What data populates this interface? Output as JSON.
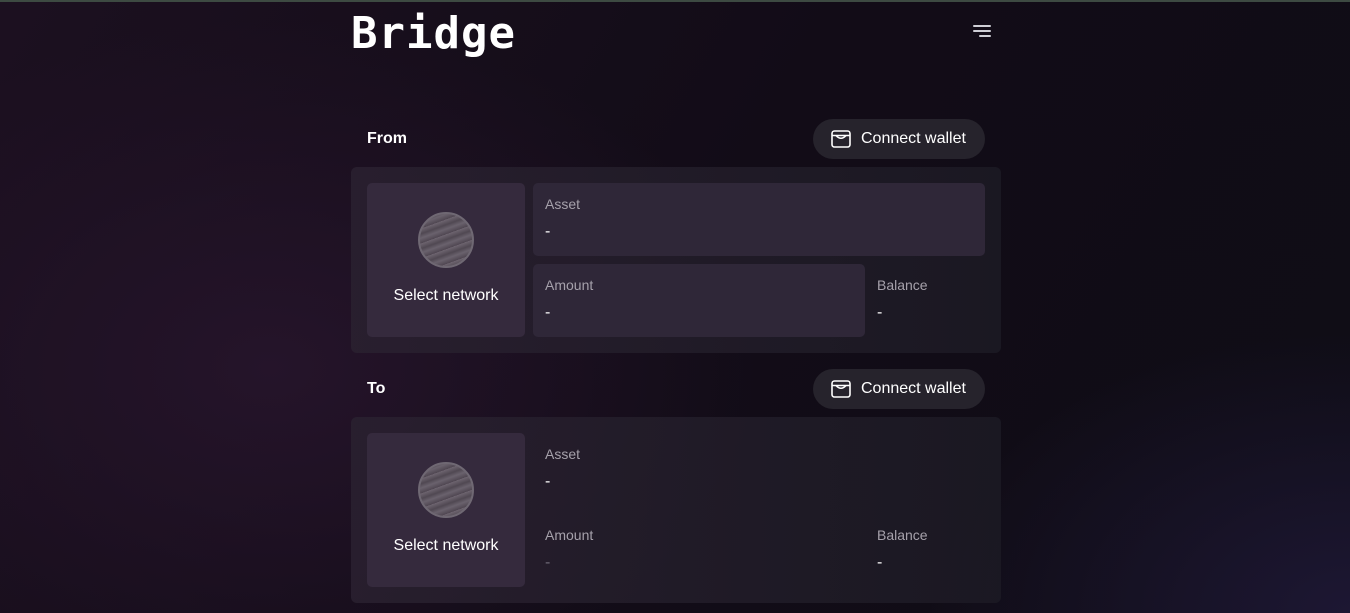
{
  "header": {
    "title": "Bridge",
    "menu_icon": "hamburger-menu-icon"
  },
  "sections": [
    {
      "label": "From",
      "wallet_button": {
        "label": "Connect wallet",
        "icon": "wallet-icon"
      },
      "network": {
        "label": "Select network",
        "icon": "network-placeholder-icon"
      },
      "asset": {
        "label": "Asset",
        "value": "-"
      },
      "amount": {
        "label": "Amount",
        "value": "-"
      },
      "balance": {
        "label": "Balance",
        "value": "-"
      }
    },
    {
      "label": "To",
      "wallet_button": {
        "label": "Connect wallet",
        "icon": "wallet-icon"
      },
      "network": {
        "label": "Select network",
        "icon": "network-placeholder-icon"
      },
      "asset": {
        "label": "Asset",
        "value": "-"
      },
      "amount": {
        "label": "Amount",
        "value": "-"
      },
      "balance": {
        "label": "Balance",
        "value": "-"
      }
    }
  ]
}
